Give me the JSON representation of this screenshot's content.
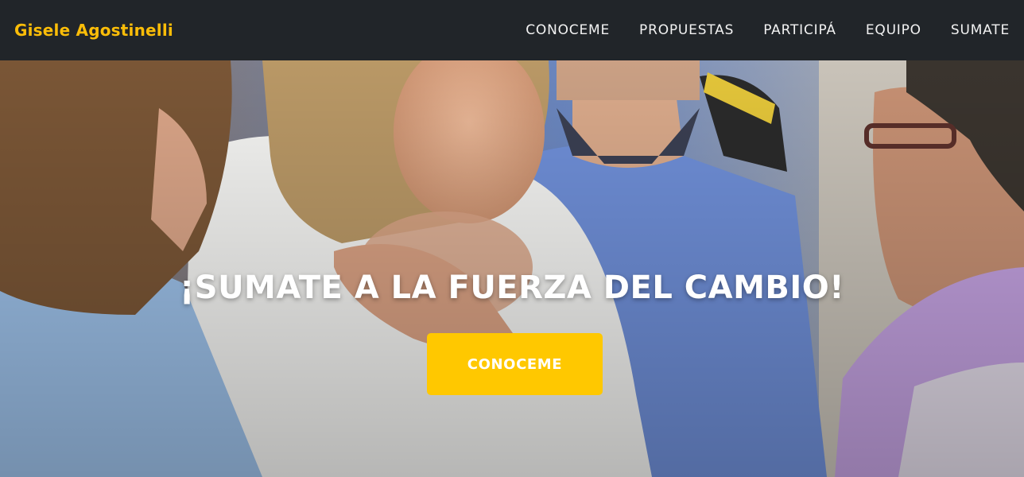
{
  "brand": {
    "name": "Gisele Agostinelli",
    "color": "#fbbd08"
  },
  "nav": {
    "items": [
      {
        "label": "CONOCEME"
      },
      {
        "label": "PROPUESTAS"
      },
      {
        "label": "PARTICIPÁ"
      },
      {
        "label": "EQUIPO"
      },
      {
        "label": "SUMATE"
      }
    ]
  },
  "hero": {
    "title": "¡SUMATE A LA FUERZA DEL CAMBIO!",
    "cta_label": "CONOCEME",
    "cta_color": "#ffc800",
    "background": "photo of candidate greeting supporters"
  },
  "theme": {
    "navbar_bg": "#212529",
    "text_light": "#f2f2f2"
  }
}
